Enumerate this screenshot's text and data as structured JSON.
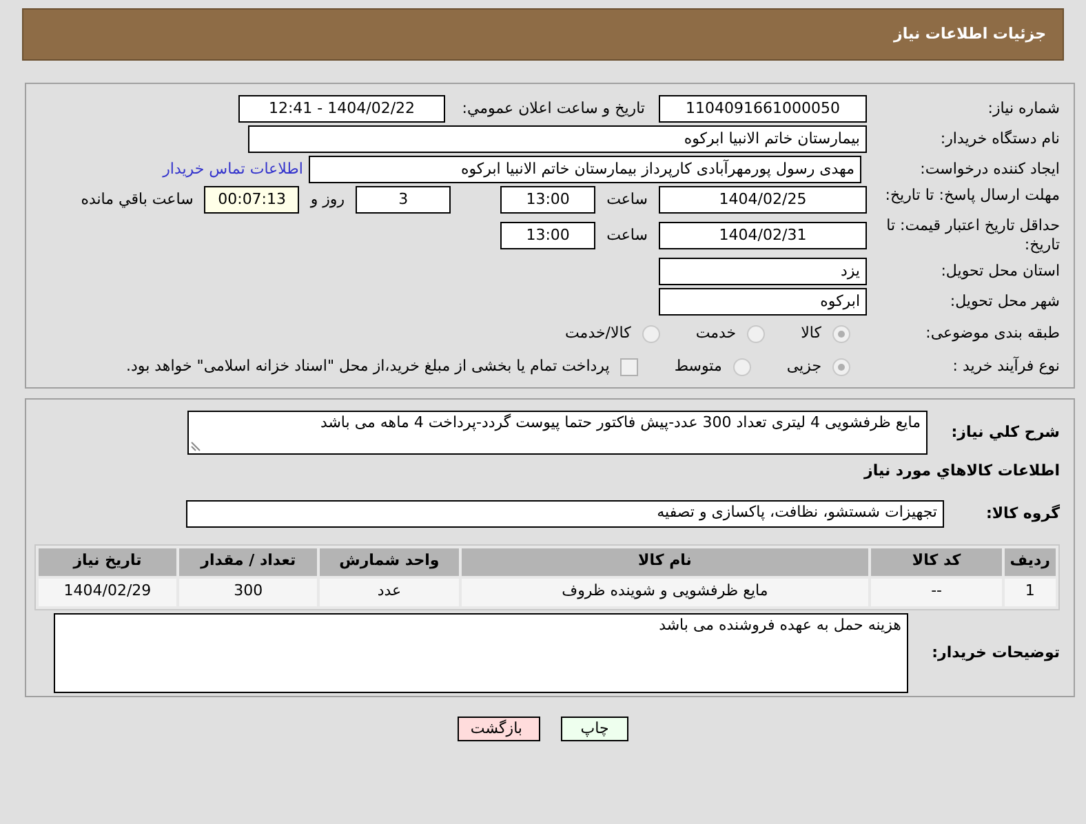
{
  "header": {
    "title": "جزئیات اطلاعات نیاز"
  },
  "details": {
    "need_number": {
      "label": "شماره نیاز:",
      "value": "1104091661000050"
    },
    "announce": {
      "label": "تاریخ و ساعت اعلان عمومي:",
      "value": "1404/02/22 - 12:41"
    },
    "buyer_org": {
      "label": "نام دستگاه خریدار:",
      "value": "بیمارستان خاتم الانبیا ابرکوه"
    },
    "requester": {
      "label": "ایجاد کننده درخواست:",
      "value": "مهدی رسول پورمهرآبادی کارپرداز بیمارستان خاتم الانبیا ابرکوه",
      "contact_link": "اطلاعات تماس خریدار"
    },
    "reply_deadline": {
      "label": "مهلت ارسال پاسخ: تا تاریخ:",
      "date": "1404/02/25",
      "time_label": "ساعت",
      "time": "13:00",
      "days": "3",
      "days_label": "روز و",
      "remaining": "00:07:13",
      "remaining_label": "ساعت باقي مانده"
    },
    "price_validity": {
      "label": "حداقل تاریخ اعتبار قیمت: تا تاریخ:",
      "date": "1404/02/31",
      "time_label": "ساعت",
      "time": "13:00"
    },
    "province": {
      "label": "استان محل تحویل:",
      "value": "یزد"
    },
    "city": {
      "label": "شهر محل تحویل:",
      "value": "ابرکوه"
    },
    "category": {
      "label": "طبقه بندی موضوعی:",
      "disabled": true,
      "options": [
        {
          "label": "کالا",
          "selected": true
        },
        {
          "label": "خدمت",
          "selected": false
        },
        {
          "label": "کالا/خدمت",
          "selected": false
        }
      ]
    },
    "process": {
      "label": "نوع فرآیند خرید :",
      "disabled": true,
      "options": [
        {
          "label": "جزیی",
          "selected": true
        },
        {
          "label": "متوسط",
          "selected": false
        }
      ],
      "treasury": {
        "label": "پرداخت تمام یا بخشی از مبلغ خرید،از محل \"اسناد خزانه اسلامی\" خواهد بود.",
        "checked": false
      }
    }
  },
  "need": {
    "description": {
      "label": "شرح کلي نیاز:",
      "value": "مایع ظرفشویی 4 لیتری تعداد 300 عدد-پیش فاکتور حتما پیوست گردد-پرداخت 4 ماهه می باشد"
    },
    "goods_title": "اطلاعات کالاهاي مورد نیاز",
    "goods_group": {
      "label": "گروه کالا:",
      "value": "تجهیزات شستشو، نظافت، پاکسازی و تصفیه"
    },
    "table": {
      "columns": [
        "ردیف",
        "کد کالا",
        "نام کالا",
        "واحد شمارش",
        "تعداد / مقدار",
        "تاریخ نیاز"
      ],
      "rows": [
        [
          "1",
          "--",
          "مایع ظرفشویی و شوینده ظروف",
          "عدد",
          "300",
          "1404/02/29"
        ]
      ]
    },
    "buyer_notes": {
      "label": "توضیحات خریدار:",
      "value": "هزینه حمل به عهده فروشنده می باشد"
    }
  },
  "buttons": [
    {
      "label": "چاپ",
      "kind": "print"
    },
    {
      "label": "بازگشت",
      "kind": "back"
    }
  ]
}
